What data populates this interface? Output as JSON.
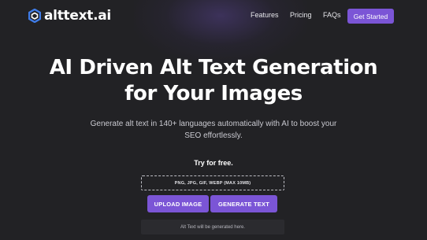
{
  "brand": {
    "name": "alttext.ai",
    "accent_color": "#7b55d6",
    "logo_icon": "hexagon-logo-icon"
  },
  "nav": {
    "items": [
      "Features",
      "Pricing",
      "FAQs"
    ],
    "cta_label": "Get Started"
  },
  "hero": {
    "title_line1": "AI Driven Alt Text Generation",
    "title_line2": "for Your Images",
    "subtitle_line1": "Generate alt text in 140+ languages automatically with AI to boost your",
    "subtitle_line2": "SEO effortlessly."
  },
  "tool": {
    "try_label": "Try for free.",
    "dropzone_text": "PNG, JPG, GIF, WEBP (MAX 10MB)",
    "upload_button": "UPLOAD IMAGE",
    "generate_button": "GENERATE TEXT",
    "output_placeholder": "Alt Text will be generated here."
  }
}
